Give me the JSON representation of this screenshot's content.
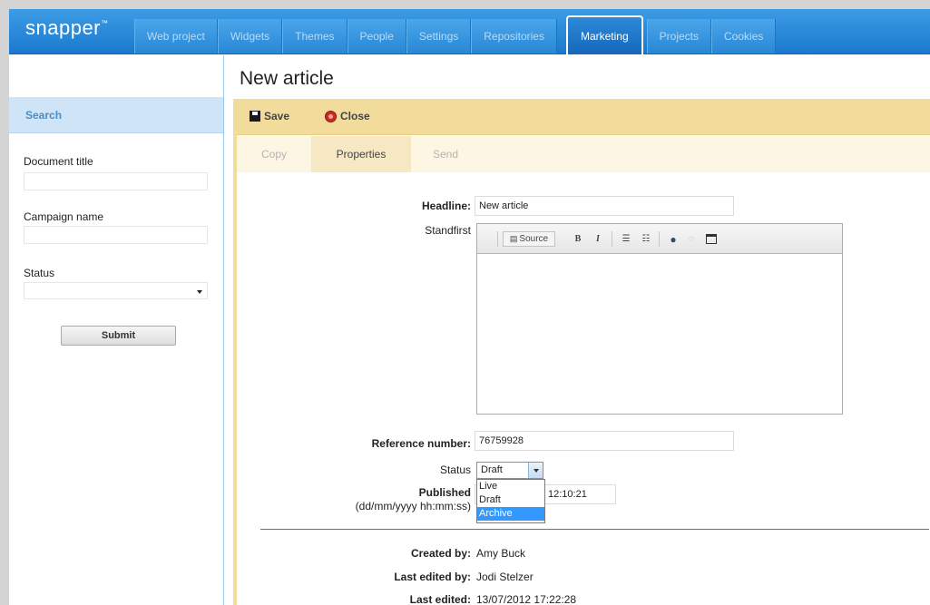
{
  "app": {
    "logo": "snapper",
    "logo_mark": "™"
  },
  "nav": {
    "tabs": [
      {
        "label": "Web project"
      },
      {
        "label": "Widgets"
      },
      {
        "label": "Themes"
      },
      {
        "label": "People"
      },
      {
        "label": "Settings"
      },
      {
        "label": "Repositories"
      },
      {
        "label": "Marketing",
        "active": true
      },
      {
        "label": "Projects"
      },
      {
        "label": "Cookies"
      }
    ]
  },
  "sidebar": {
    "heading": "Search",
    "document_title_label": "Document title",
    "document_title_value": "",
    "campaign_name_label": "Campaign name",
    "campaign_name_value": "",
    "status_label": "Status",
    "status_value": "",
    "submit_label": "Submit"
  },
  "page": {
    "title": "New article"
  },
  "toolbar": {
    "save_label": "Save",
    "close_label": "Close"
  },
  "subtabs": [
    {
      "label": "Copy"
    },
    {
      "label": "Properties",
      "active": true
    },
    {
      "label": "Send"
    }
  ],
  "form": {
    "headline_label": "Headline:",
    "headline_value": "New article",
    "standfirst_label": "Standfirst",
    "editor": {
      "source_label": "Source",
      "bold_label": "B",
      "italic_label": "I"
    },
    "reference_label": "Reference number:",
    "reference_value": "76759928",
    "status_label": "Status",
    "status_value": "Draft",
    "status_options": [
      "Live",
      "Draft",
      "Archive"
    ],
    "published_label": "Published",
    "published_format": "(dd/mm/yyyy hh:mm:ss)",
    "published_value": "12:10:21"
  },
  "meta": {
    "created_by_label": "Created by:",
    "created_by_value": "Amy Buck",
    "last_edited_by_label": "Last edited by:",
    "last_edited_by_value": "Jodi Stelzer",
    "last_edited_label": "Last edited:",
    "last_edited_value": "13/07/2012 17:22:28"
  },
  "colors": {
    "nav_blue": "#1a79cd",
    "sidebar_header": "#cfe4f6",
    "toolbar_gold": "#f2dc9b",
    "dropdown_highlight": "#3399ff"
  }
}
